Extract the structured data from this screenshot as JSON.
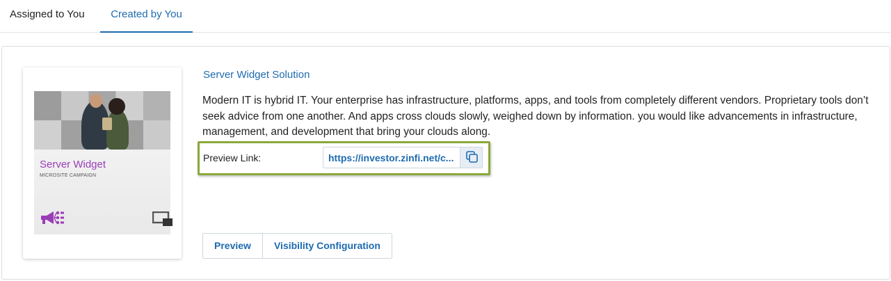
{
  "tabs": [
    {
      "label": "Assigned to You",
      "active": false
    },
    {
      "label": "Created by You",
      "active": true
    }
  ],
  "card": {
    "title": "Server Widget",
    "subtitle": "MICROSITE CAMPAIGN",
    "icons": [
      "megaphone-share-icon",
      "screen-icon"
    ]
  },
  "item": {
    "title": "Server Widget Solution",
    "description": "Modern IT is hybrid IT. Your enterprise has infrastructure, platforms, apps, and tools from completely different vendors. Proprietary tools don’t seek advice from one another. And apps cross clouds slowly, weighed down by information. you would like advancements in infrastructure, management, and development that bring your clouds along.",
    "preview_label": "Preview Link:",
    "preview_link": "https://investor.zinfi.net/c..."
  },
  "buttons": {
    "preview": "Preview",
    "visibility": "Visibility Configuration"
  },
  "colors": {
    "accent": "#1e6bb0",
    "card_title": "#9b3db8",
    "highlight": "#8aa83a"
  }
}
